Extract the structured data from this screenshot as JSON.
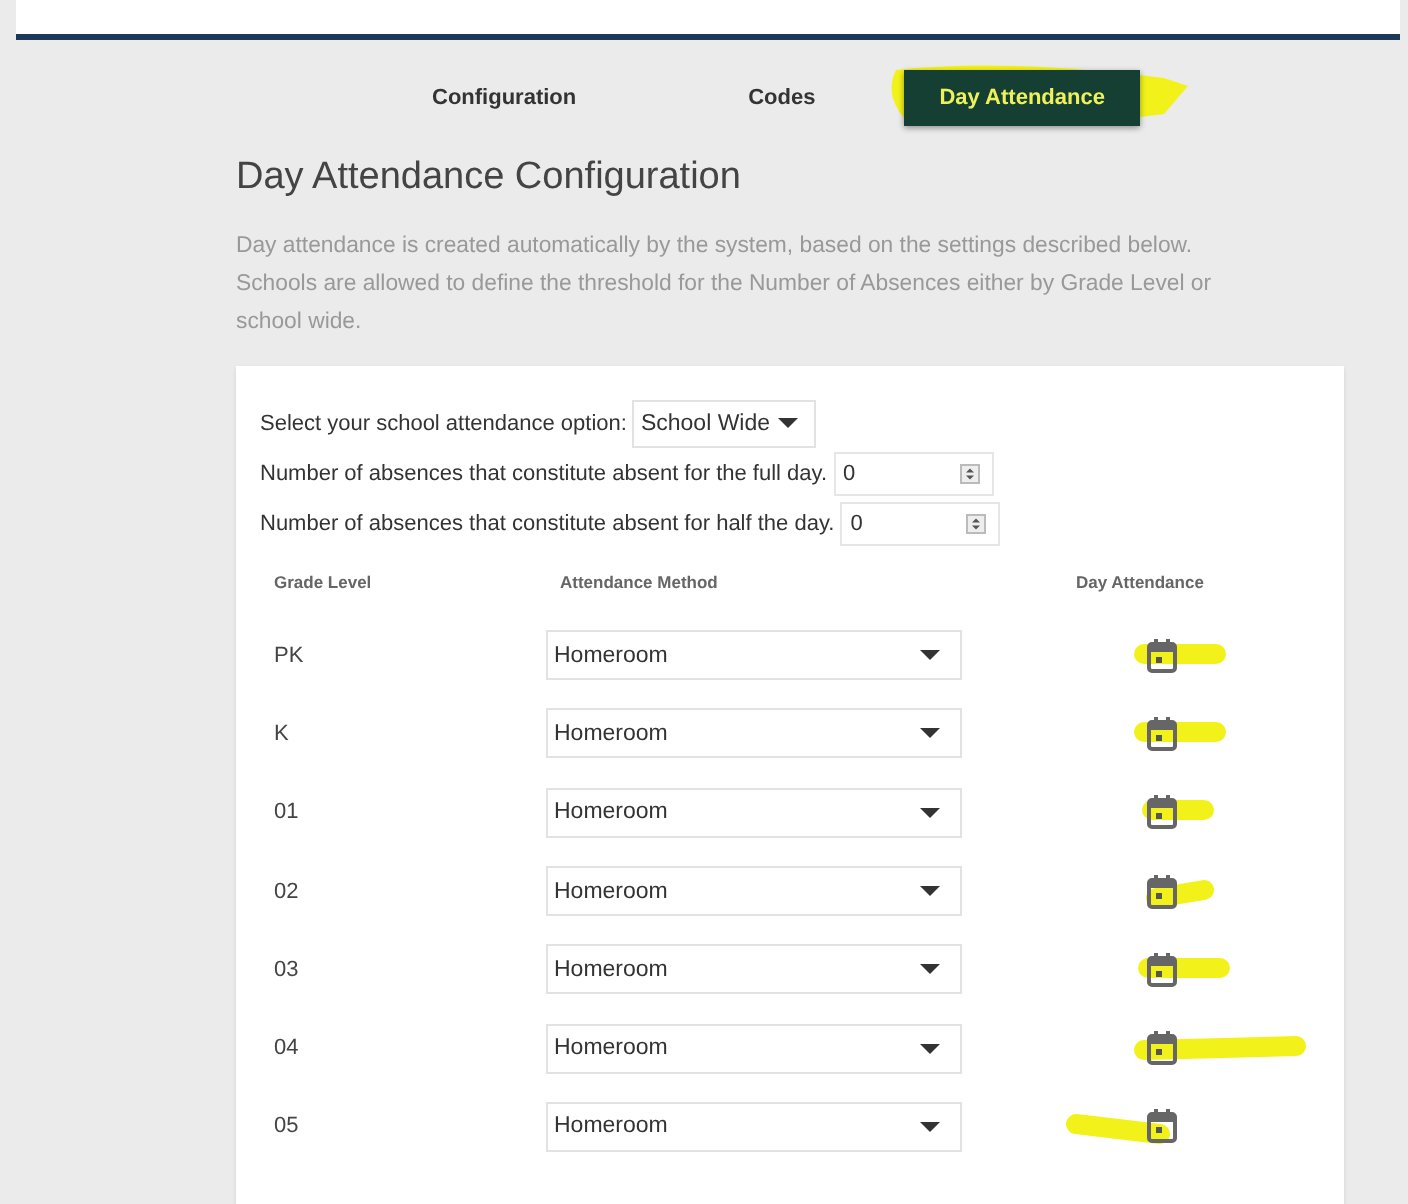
{
  "tabs": [
    {
      "label": "Configuration",
      "selected": false
    },
    {
      "label": "Codes",
      "selected": false
    },
    {
      "label": "Day Attendance",
      "selected": true
    }
  ],
  "title": "Day Attendance Configuration",
  "description": "Day attendance is created automatically by the system, based on the settings described below. Schools are allowed to define the threshold for the Number of Absences either by Grade Level or school wide.",
  "settings": [
    {
      "kind": "select",
      "label": "Select your school attendance option:",
      "value": "School Wide"
    },
    {
      "kind": "number",
      "label": "Number of absences that constitute absent for the full day.",
      "value": "0"
    },
    {
      "kind": "number",
      "label": "Number of absences that constitute absent for half the day.",
      "value": "0"
    }
  ],
  "table": {
    "columns": [
      "Grade Level",
      "Attendance Method",
      "Day Attendance"
    ],
    "rows": [
      {
        "grade": "PK",
        "method": "Homeroom"
      },
      {
        "grade": "K",
        "method": "Homeroom"
      },
      {
        "grade": "01",
        "method": "Homeroom"
      },
      {
        "grade": "02",
        "method": "Homeroom"
      },
      {
        "grade": "03",
        "method": "Homeroom"
      },
      {
        "grade": "04",
        "method": "Homeroom"
      },
      {
        "grade": "05",
        "method": "Homeroom"
      }
    ]
  }
}
